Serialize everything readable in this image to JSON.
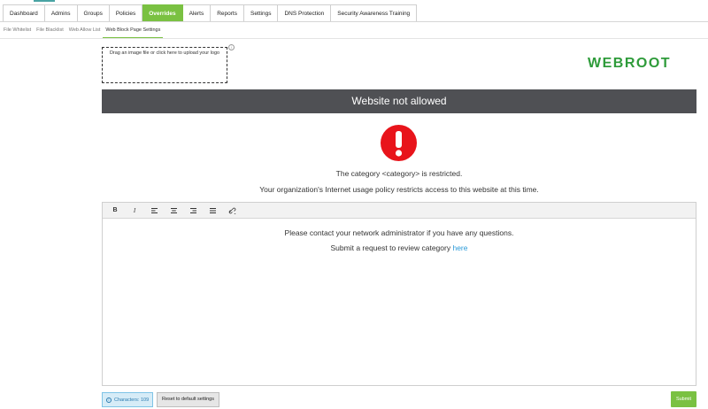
{
  "main_tabs": [
    {
      "label": "Dashboard",
      "active": false
    },
    {
      "label": "Admins",
      "active": false
    },
    {
      "label": "Groups",
      "active": false
    },
    {
      "label": "Policies",
      "active": false
    },
    {
      "label": "Overrides",
      "active": true
    },
    {
      "label": "Alerts",
      "active": false
    },
    {
      "label": "Reports",
      "active": false
    },
    {
      "label": "Settings",
      "active": false
    },
    {
      "label": "DNS Protection",
      "active": false
    },
    {
      "label": "Security Awareness Training",
      "active": false
    }
  ],
  "sub_tabs": [
    {
      "label": "File Whitelist",
      "active": false
    },
    {
      "label": "File Blacklist",
      "active": false
    },
    {
      "label": "Web Allow List",
      "active": false
    },
    {
      "label": "Web Block Page Settings",
      "active": true
    }
  ],
  "upload": {
    "text": "Drag an image file or click here to upload your logo",
    "info_icon": "i"
  },
  "logo": {
    "text": "WEBROOT",
    "color": "#2e9b3a"
  },
  "banner": {
    "title": "Website not allowed",
    "color": "#4f5054"
  },
  "alert_icon": {
    "name": "exclamation-circle-icon",
    "color": "#e8141b"
  },
  "messages": {
    "category": "The category <category> is restricted.",
    "policy": "Your organization's Internet usage policy restricts access to this website at this time."
  },
  "toolbar": {
    "bold_label": "B",
    "italic_label": "I",
    "icons": [
      "align-left-icon",
      "align-center-icon",
      "align-right-icon",
      "align-justify-icon",
      "link-icon"
    ]
  },
  "editor": {
    "line1": "Please contact your network administrator if you have any questions.",
    "line2_prefix": "Submit a request to review category",
    "line2_link": "here"
  },
  "footer": {
    "characters_label": "Characters: 109",
    "reset_label": "Reset to default settings",
    "submit_label": "Submit"
  },
  "colors": {
    "accent": "#7ac142",
    "link": "#2a9ad8"
  }
}
